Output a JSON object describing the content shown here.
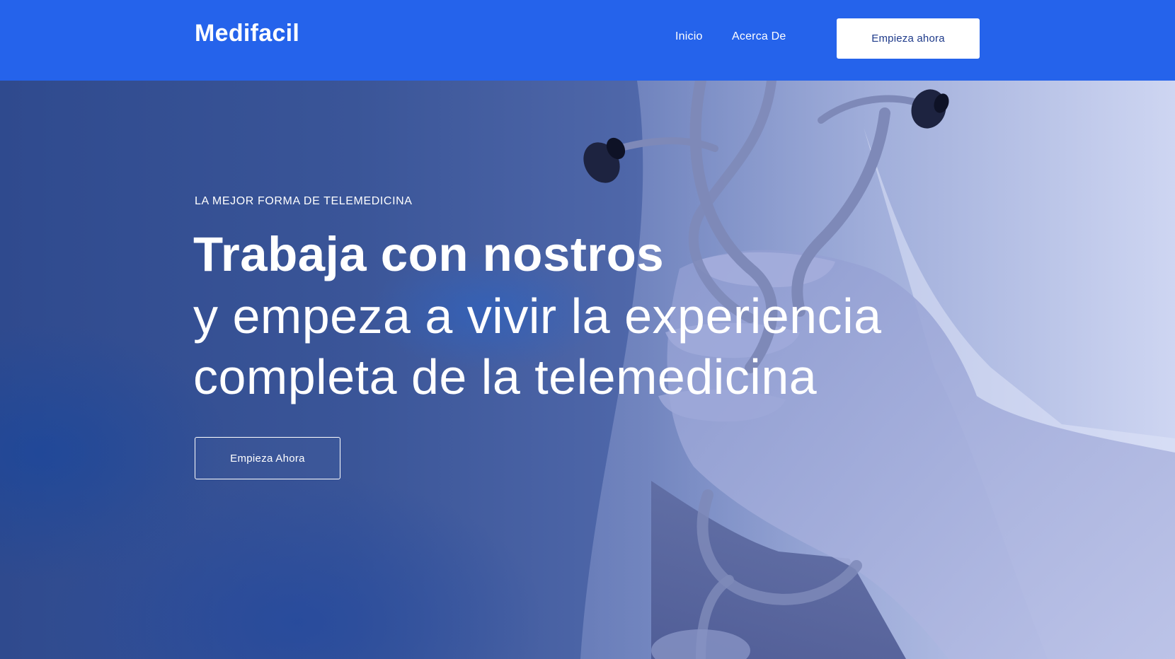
{
  "nav": {
    "brand": "Medifacil",
    "links": [
      {
        "label": "Inicio"
      },
      {
        "label": "Acerca De"
      }
    ],
    "cta_label": "Empieza ahora"
  },
  "hero": {
    "eyebrow": "LA MEJOR FORMA DE TELEMEDICINA",
    "headline_bold": "Trabaja con nostros",
    "headline_line_1": "y empeza a vivir la experiencia",
    "headline_line_2": "completa de la telemedicina",
    "cta_label": "Empieza Ahora",
    "background_description_icons": [
      "stethoscope-illustration"
    ]
  },
  "colors": {
    "nav_background": "#2563eb",
    "hero_overlay": "#3a5598",
    "text": "#ffffff",
    "nav_cta_text": "#1e3a8a"
  }
}
